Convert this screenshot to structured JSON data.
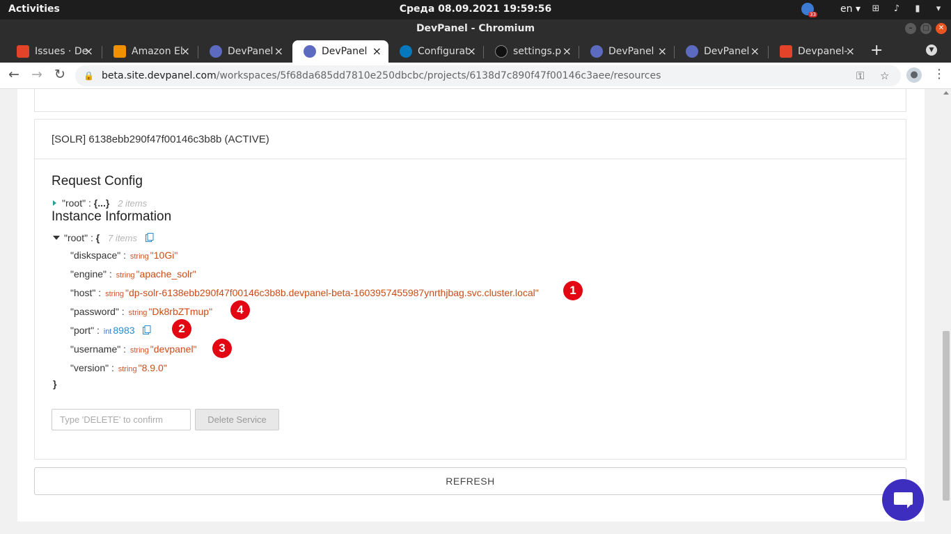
{
  "topbar": {
    "activities": "Activities",
    "clock": "Среда 08.09.2021 19:59:56",
    "lang": "en ▾",
    "badge_count": "33"
  },
  "window": {
    "title": "DevPanel - Chromium"
  },
  "tabs": [
    {
      "label": "Issues · De",
      "icon": "gitlab-icon",
      "color": "#e24329"
    },
    {
      "label": "Amazon El",
      "icon": "aws-icon",
      "color": "#f29100"
    },
    {
      "label": "DevPanel",
      "icon": "devpanel-icon",
      "color": "#3f51b5"
    },
    {
      "label": "DevPanel",
      "icon": "devpanel-icon",
      "color": "#3f51b5",
      "active": true
    },
    {
      "label": "Configurat",
      "icon": "drupal-icon",
      "color": "#0678be"
    },
    {
      "label": "settings.p",
      "icon": "github-icon",
      "color": "#111111"
    },
    {
      "label": "DevPanel",
      "icon": "devpanel-icon",
      "color": "#3f51b5"
    },
    {
      "label": "DevPanel",
      "icon": "devpanel-icon",
      "color": "#3f51b5"
    },
    {
      "label": "Devpanel-",
      "icon": "gitlab-icon",
      "color": "#e24329"
    }
  ],
  "address": {
    "host": "beta.site.devpanel.com",
    "path": "/workspaces/5f68da685dd7810e250dbcbc/projects/6138d7c890f47f00146c3aee/resources"
  },
  "service": {
    "header": "[SOLR] 6138ebb290f47f00146c3b8b (ACTIVE)",
    "request_config_title": "Request Config",
    "request_root_key": "\"root\"",
    "request_root_collapsed": "{...}",
    "request_root_count": "2 items",
    "instance_title": "Instance Information",
    "instance_root_key": "\"root\"",
    "instance_root_open": "{",
    "instance_root_count": "7 items",
    "instance_root_close": "}",
    "fields": [
      {
        "key": "\"diskspace\"",
        "type": "string",
        "value": "\"10Gi\""
      },
      {
        "key": "\"engine\"",
        "type": "string",
        "value": "\"apache_solr\""
      },
      {
        "key": "\"host\"",
        "type": "string",
        "value": "\"dp-solr-6138ebb290f47f00146c3b8b.devpanel-beta-1603957455987ynrthjbag.svc.cluster.local\""
      },
      {
        "key": "\"password\"",
        "type": "string",
        "value": "\"Dk8rbZTmup\""
      },
      {
        "key": "\"port\"",
        "type": "int",
        "value": "8983"
      },
      {
        "key": "\"username\"",
        "type": "string",
        "value": "\"devpanel\""
      },
      {
        "key": "\"version\"",
        "type": "string",
        "value": "\"8.9.0\""
      }
    ],
    "annotations": [
      "1",
      "4",
      "2",
      "3"
    ],
    "delete_placeholder": "Type 'DELETE' to confirm",
    "delete_label": "Delete Service"
  },
  "refresh_label": "REFRESH",
  "colors": {
    "accent": "#3d2ebf",
    "annotation": "#e30613",
    "json_string": "#cb4b16",
    "json_int": "#268bd2"
  }
}
